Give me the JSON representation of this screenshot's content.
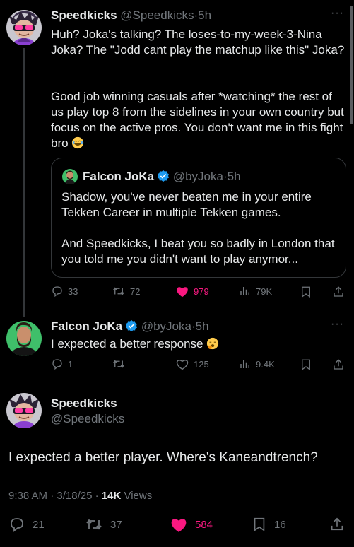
{
  "tweet1": {
    "name": "Speedkicks",
    "handle": "@Speedkicks",
    "time": "5h",
    "text_p1": "Huh? Joka's talking? The loses-to-my-week-3-Nina Joka? The \"Jodd cant play the matchup like this\" Joka?",
    "text_p2": "Good job winning casuals after *watching* the rest of us play top 8 from the sidelines in your own country but focus on the active pros. You don't want me in this fight bro",
    "emoji": "laughing-emoji",
    "quote": {
      "name": "Falcon JoKa",
      "handle": "@byJoka",
      "time": "5h",
      "text_p1": "Shadow, you've never beaten me in your entire Tekken Career in multiple Tekken games.",
      "text_p2": "And Speedkicks, I beat you so badly in London that you told me you didn't want to play anymor..."
    },
    "actions": {
      "replies": "33",
      "reposts": "72",
      "likes": "979",
      "views": "79K"
    }
  },
  "tweet2": {
    "name": "Falcon JoKa",
    "handle": "@byJoka",
    "time": "5h",
    "text": "I expected a better response",
    "emoji": "yawning-emoji",
    "actions": {
      "replies": "1",
      "reposts": "",
      "likes": "125",
      "views": "9.4K"
    }
  },
  "detail": {
    "name": "Speedkicks",
    "handle": "@Speedkicks",
    "text": "I expected a better player. Where's Kaneandtrench?",
    "time": "9:38 AM",
    "date": "3/18/25",
    "views_count": "14K",
    "views_label": "Views",
    "actions": {
      "replies": "21",
      "reposts": "37",
      "likes": "584",
      "bookmarks": "16"
    }
  },
  "colors": {
    "like": "#f91880",
    "verified": "#1d9bf0",
    "muted": "#71767b",
    "border": "#333639"
  },
  "separator": "·"
}
